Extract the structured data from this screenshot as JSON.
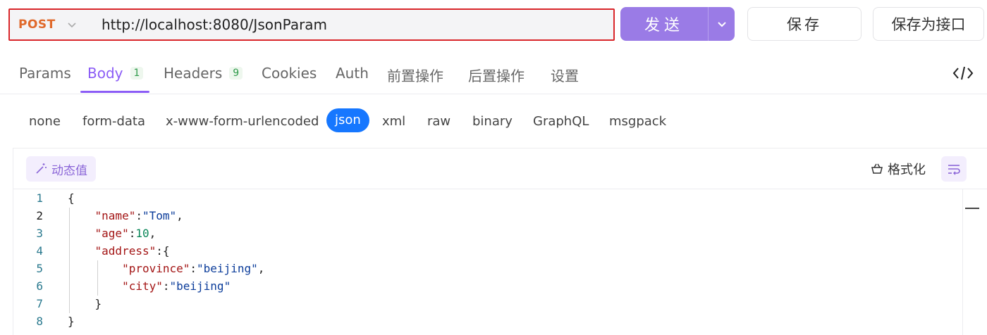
{
  "request": {
    "method": "POST",
    "url": "http://localhost:8080/JsonParam",
    "send_label": "发送",
    "save_label": "保存",
    "save_as_api_label": "保存为接口"
  },
  "tabs": [
    {
      "label": "Params"
    },
    {
      "label": "Body",
      "badge": "1",
      "active": true
    },
    {
      "label": "Headers",
      "badge": "9"
    },
    {
      "label": "Cookies"
    },
    {
      "label": "Auth"
    },
    {
      "label": "前置操作"
    },
    {
      "label": "后置操作"
    },
    {
      "label": "设置"
    }
  ],
  "body_types": [
    "none",
    "form-data",
    "x-www-form-urlencoded",
    "json",
    "xml",
    "raw",
    "binary",
    "GraphQL",
    "msgpack"
  ],
  "body_type_selected": "json",
  "editor": {
    "dynamic_value_label": "动态值",
    "format_label": "格式化",
    "line_numbers": [
      "1",
      "2",
      "3",
      "4",
      "5",
      "6",
      "7",
      "8"
    ],
    "lines": [
      "{",
      "    \"name\":\"Tom\",",
      "    \"age\":10,",
      "    \"address\":{",
      "        \"province\":\"beijing\",",
      "        \"city\":\"beijing\"",
      "    }",
      "}"
    ]
  },
  "colors": {
    "accent": "#8b5cf6",
    "send_button": "#9a7be6",
    "method": "#e0692b",
    "selected_chip": "#1677ff",
    "highlight_border": "#d9262a"
  },
  "icons": {
    "method_dropdown": "chevron-down-icon",
    "send_dropdown": "chevron-down-icon",
    "code_view": "code-icon",
    "dynamic_value": "magic-wand-icon",
    "format": "basket-icon",
    "wrap": "wrap-lines-icon"
  }
}
